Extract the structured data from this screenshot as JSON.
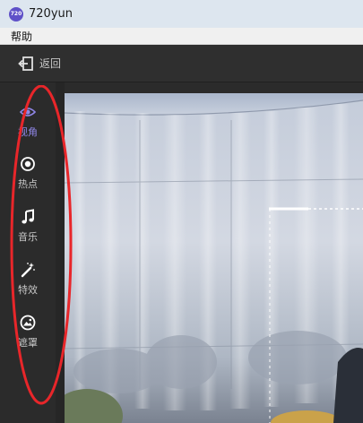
{
  "window": {
    "title": "720yun",
    "app_icon_text": "720"
  },
  "menubar": {
    "items": [
      {
        "label": "帮助"
      }
    ]
  },
  "toolbar": {
    "back_label": "返回",
    "back_icon": "exit-icon"
  },
  "sidebar": {
    "active_color": "#8f86e6",
    "items": [
      {
        "label": "视角",
        "icon": "eye-icon",
        "active": true
      },
      {
        "label": "热点",
        "icon": "target-icon",
        "active": false
      },
      {
        "label": "音乐",
        "icon": "music-note-icon",
        "active": false
      },
      {
        "label": "特效",
        "icon": "magic-wand-icon",
        "active": false
      },
      {
        "label": "遮罩",
        "icon": "image-icon",
        "active": false
      }
    ]
  },
  "annotation": {
    "shape": "ellipse",
    "color": "#e8262a"
  },
  "viewport": {
    "content": "panorama-image"
  }
}
